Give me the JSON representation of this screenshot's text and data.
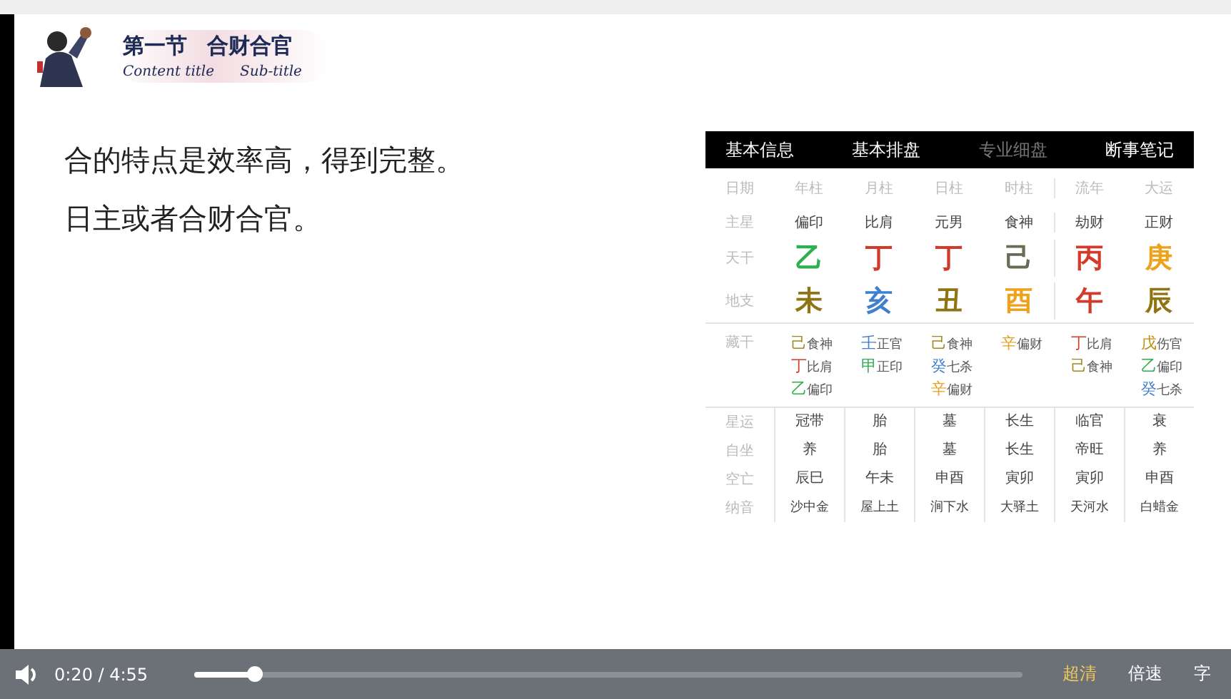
{
  "slide": {
    "title": {
      "section": "第一节",
      "name": "合财合官"
    },
    "subtitle": {
      "content": "Content title",
      "sub": "Sub-title"
    },
    "lines": [
      "合的特点是效率高，得到完整。",
      "日主或者合财合官。"
    ]
  },
  "chart_panel": {
    "tabs": [
      {
        "label": "基本信息",
        "selected": false
      },
      {
        "label": "基本排盘",
        "selected": false
      },
      {
        "label": "专业细盘",
        "selected": true
      },
      {
        "label": "断事笔记",
        "selected": false
      }
    ],
    "header": {
      "label": "日期",
      "cells": [
        "年柱",
        "月柱",
        "日柱",
        "时柱",
        "流年",
        "大运"
      ]
    },
    "rows": [
      {
        "kind": "text",
        "label": "主星",
        "cells": [
          {
            "text": "偏印"
          },
          {
            "text": "比肩"
          },
          {
            "text": "元男"
          },
          {
            "text": "食神"
          },
          {
            "text": "劫财"
          },
          {
            "text": "正财"
          }
        ]
      },
      {
        "kind": "big",
        "label": "天干",
        "cells": [
          {
            "text": "乙",
            "color": "#2fb04e"
          },
          {
            "text": "丁",
            "color": "#d23a2a"
          },
          {
            "text": "丁",
            "color": "#d23a2a"
          },
          {
            "text": "己",
            "color": "#6a6a55"
          },
          {
            "text": "丙",
            "color": "#d23a2a"
          },
          {
            "text": "庚",
            "color": "#eea21c"
          }
        ]
      },
      {
        "kind": "big",
        "label": "地支",
        "cells": [
          {
            "text": "未",
            "color": "#8f7414"
          },
          {
            "text": "亥",
            "color": "#3f7fd0"
          },
          {
            "text": "丑",
            "color": "#8f7414"
          },
          {
            "text": "酉",
            "color": "#eea21c"
          },
          {
            "text": "午",
            "color": "#d23a2a"
          },
          {
            "text": "辰",
            "color": "#8f7414"
          }
        ]
      },
      {
        "kind": "hidden",
        "label": "藏干",
        "cells": [
          [
            {
              "stem": "己",
              "color": "#a08a20",
              "god": "食神"
            },
            {
              "stem": "丁",
              "color": "#d23a2a",
              "god": "比肩"
            },
            {
              "stem": "乙",
              "color": "#2fb04e",
              "god": "偏印"
            }
          ],
          [
            {
              "stem": "壬",
              "color": "#3f7fd0",
              "god": "正官"
            },
            {
              "stem": "甲",
              "color": "#2fb04e",
              "god": "正印"
            }
          ],
          [
            {
              "stem": "己",
              "color": "#a08a20",
              "god": "食神"
            },
            {
              "stem": "癸",
              "color": "#3f7fd0",
              "god": "七杀"
            },
            {
              "stem": "辛",
              "color": "#e8a020",
              "god": "偏财"
            }
          ],
          [
            {
              "stem": "辛",
              "color": "#e8a020",
              "god": "偏财"
            }
          ],
          [
            {
              "stem": "丁",
              "color": "#d23a2a",
              "god": "比肩"
            },
            {
              "stem": "己",
              "color": "#a08a20",
              "god": "食神"
            }
          ],
          [
            {
              "stem": "戊",
              "color": "#c09010",
              "god": "伤官"
            },
            {
              "stem": "乙",
              "color": "#2fb04e",
              "god": "偏印"
            },
            {
              "stem": "癸",
              "color": "#3f7fd0",
              "god": "七杀"
            }
          ]
        ]
      },
      {
        "kind": "grid",
        "label": "星运",
        "cells": [
          {
            "text": "冠带"
          },
          {
            "text": "胎"
          },
          {
            "text": "墓"
          },
          {
            "text": "长生"
          },
          {
            "text": "临官"
          },
          {
            "text": "衰"
          }
        ]
      },
      {
        "kind": "grid",
        "label": "自坐",
        "cells": [
          {
            "text": "养"
          },
          {
            "text": "胎"
          },
          {
            "text": "墓"
          },
          {
            "text": "长生"
          },
          {
            "text": "帝旺"
          },
          {
            "text": "养"
          }
        ]
      },
      {
        "kind": "grid",
        "label": "空亡",
        "cells": [
          {
            "text": "辰巳"
          },
          {
            "text": "午未"
          },
          {
            "text": "申酉"
          },
          {
            "text": "寅卯"
          },
          {
            "text": "寅卯"
          },
          {
            "text": "申酉"
          }
        ]
      },
      {
        "kind": "small",
        "label": "纳音",
        "cells": [
          {
            "text": "沙中金"
          },
          {
            "text": "屋上土"
          },
          {
            "text": "涧下水"
          },
          {
            "text": "大驿土"
          },
          {
            "text": "天河水"
          },
          {
            "text": "白蜡金"
          }
        ]
      }
    ]
  },
  "player": {
    "time": "0:20 / 4:55",
    "progress": {
      "level": 0.074
    },
    "buttons": [
      {
        "label": "超清",
        "selected": true
      },
      {
        "label": "倍速",
        "selected": false
      },
      {
        "label": "字",
        "selected": false
      }
    ]
  }
}
